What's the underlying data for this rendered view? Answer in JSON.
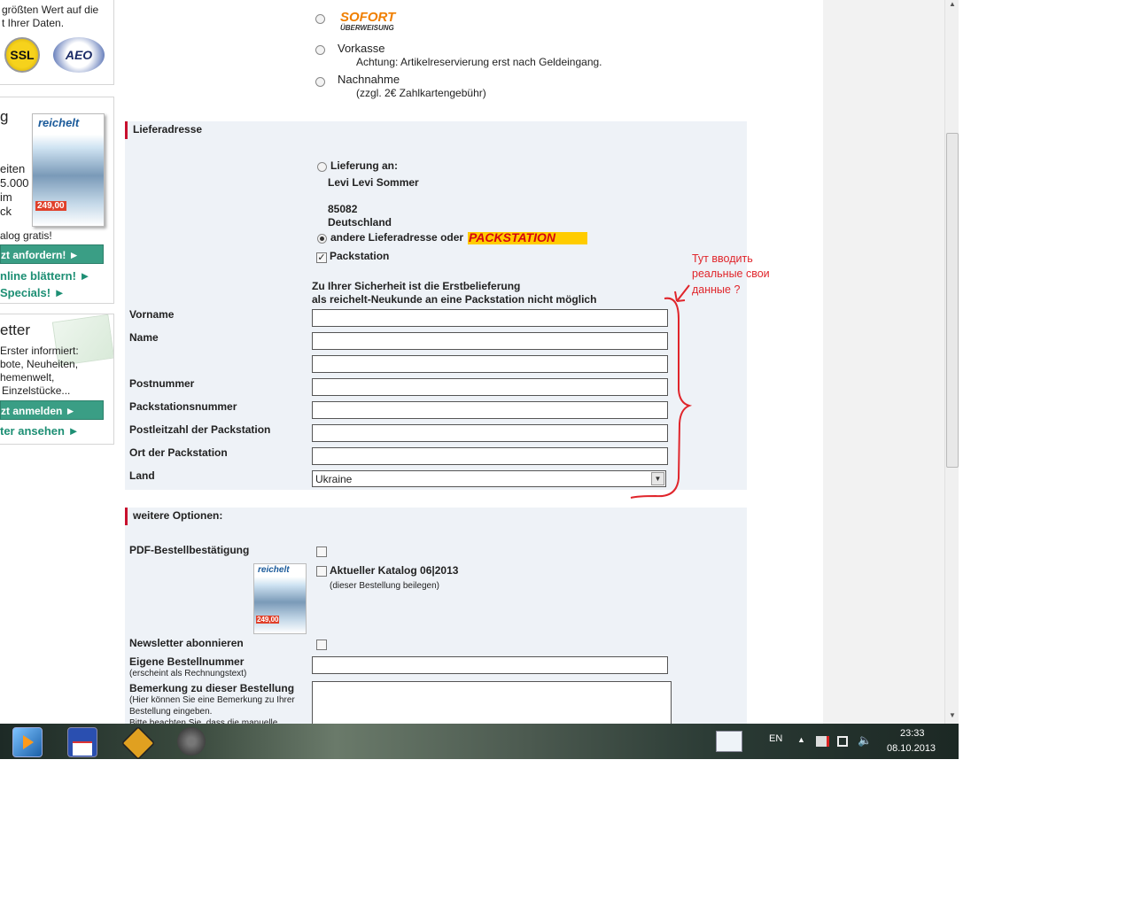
{
  "sidebar": {
    "trust_line1": "größten Wert auf die",
    "trust_line2": "t Ihrer Daten.",
    "ssl_badge": "SSL",
    "aeo_badge": "AEO",
    "catalog_heading": "g",
    "catalog_line1": "eiten",
    "catalog_line2": "5.000",
    "catalog_line3": "im",
    "catalog_line4": "ck",
    "catalog_free": "alog gratis!",
    "catalog_order_button": "zt anfordern! ►",
    "catalog_online_link": "nline blättern! ►",
    "specials_link": "Specials! ►",
    "newsletter_heading": "etter",
    "newsletter_line1": "Erster informiert:",
    "newsletter_line2": "bote, Neuheiten,",
    "newsletter_line3": "hemenwelt,",
    "newsletter_line4": "Einzelstücke...",
    "newsletter_button": "zt anmelden ►",
    "newsletter_view_link": "ter ansehen ►",
    "catalog_cover_brand": "reichelt",
    "catalog_cover_price": "249,00"
  },
  "payment": {
    "sofort_logo": "SOFORT",
    "sofort_sub": "ÜBERWEISUNG",
    "vorkasse_label": "Vorkasse",
    "vorkasse_note": "Achtung: Artikelreservierung erst nach Geldeingang.",
    "nachnahme_label": "Nachnahme",
    "nachnahme_note": "(zzgl. 2€ Zahlkartengebühr)"
  },
  "delivery": {
    "title": "Lieferadresse",
    "deliver_to_label": "Lieferung an:",
    "address_name": "Levi Levi Sommer",
    "address_zip": "85082",
    "address_country": "Deutschland",
    "other_address_label": "andere Lieferadresse oder",
    "packstation_logo": "PACKSTATION",
    "packstation_checkbox_label": "Packstation",
    "packstation_checked": true,
    "security_note_line1": "Zu Ihrer Sicherheit ist die Erstbelieferung",
    "security_note_line2": "als reichelt-Neukunde an eine Packstation nicht möglich",
    "fields": {
      "vorname_label": "Vorname",
      "name_label": "Name",
      "postnummer_label": "Postnummer",
      "packstationsnummer_label": "Packstationsnummer",
      "plz_label": "Postleitzahl der Packstation",
      "ort_label": "Ort der Packstation",
      "land_label": "Land",
      "land_value": "Ukraine"
    }
  },
  "annotation": {
    "line1": "Тут вводить",
    "line2": "реальные свои",
    "line3": "данные ?",
    "color": "#e0252b"
  },
  "options": {
    "title": "weitere Optionen:",
    "pdf_label": "PDF-Bestellbestätigung",
    "catalog_label": "Aktueller Katalog 06|2013",
    "catalog_note": "(dieser Bestellung beilegen)",
    "newsletter_label": "Newsletter abonnieren",
    "order_number_label": "Eigene Bestellnummer",
    "order_number_note": "(erscheint als Rechnungstext)",
    "remark_label": "Bemerkung zu dieser Bestellung",
    "remark_note_line1": "(Hier können Sie eine Bemerkung zu Ihrer",
    "remark_note_line2": "Bestellung eingeben.",
    "remark_note_line3": "Bitte beachten Sie, dass die manuelle"
  },
  "taskbar": {
    "language": "EN",
    "time": "23:33",
    "date": "08.10.2013"
  },
  "colors": {
    "accent_red": "#c8102e",
    "sidebar_green": "#3a9e85",
    "section_bg": "#eef2f7",
    "packstation_yellow": "#ffcc00"
  }
}
